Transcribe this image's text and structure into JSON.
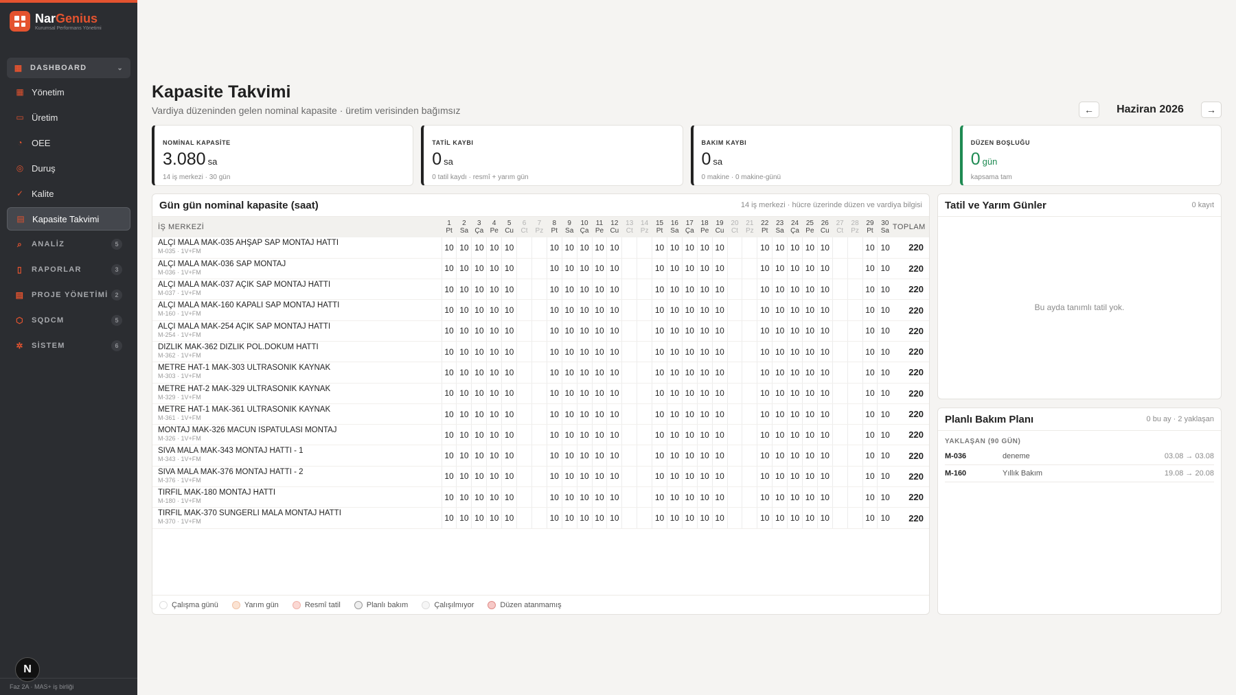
{
  "brand": {
    "name_a": "Nar",
    "name_b": "Genius",
    "subtitle": "Kurumsal Performans Yönetimi"
  },
  "sidebar": {
    "group_label": "DASHBOARD",
    "items": [
      {
        "label": "Yönetim",
        "icon": "grid-icon"
      },
      {
        "label": "Üretim",
        "icon": "factory-icon"
      },
      {
        "label": "OEE",
        "icon": "gauge-icon"
      },
      {
        "label": "Duruş",
        "icon": "pause-icon"
      },
      {
        "label": "Kalite",
        "icon": "check-icon"
      },
      {
        "label": "Kapasite Takvimi",
        "icon": "calendar-icon",
        "active": true
      }
    ],
    "sections": [
      {
        "label": "ANALİZ",
        "badge": "5",
        "icon": "search-icon"
      },
      {
        "label": "RAPORLAR",
        "badge": "3",
        "icon": "document-icon"
      },
      {
        "label": "PROJE YÖNETİMİ",
        "badge": "2",
        "icon": "board-icon"
      },
      {
        "label": "SQDCM",
        "badge": "5",
        "icon": "shield-icon"
      },
      {
        "label": "SİSTEM",
        "badge": "6",
        "icon": "gear-icon"
      }
    ],
    "avatar": "N",
    "footer": "Faz 2A · MAS+ iş birliği"
  },
  "page": {
    "title": "Kapasite Takvimi",
    "subtitle": "Vardiya düzeninden gelen nominal kapasite · üretim verisinden bağımsız",
    "month": "Haziran 2026",
    "prev": "←",
    "next": "→"
  },
  "kpis": [
    {
      "label": "NOMİNAL KAPASİTE",
      "value": "3.080",
      "unit": "sa",
      "foot": "14 iş merkezi · 30 gün"
    },
    {
      "label": "TATİL KAYBI",
      "value": "0",
      "unit": "sa",
      "foot": "0 tatil kaydı · resmî + yarım gün"
    },
    {
      "label": "BAKIM KAYBI",
      "value": "0",
      "unit": "sa",
      "foot": "0 makine · 0 makine-günü"
    },
    {
      "label": "DÜZEN BOŞLUĞU",
      "value": "0",
      "unit": "gün",
      "foot": "kapsama tam"
    }
  ],
  "table": {
    "title": "Gün gün nominal kapasite (saat)",
    "meta": "14 iş merkezi · hücre üzerinde düzen ve vardiya bilgisi",
    "col_wc": "İŞ MERKEZİ",
    "col_total": "TOPLAM",
    "days": [
      {
        "n": "1",
        "w": "Pt",
        "we": false
      },
      {
        "n": "2",
        "w": "Sa",
        "we": false
      },
      {
        "n": "3",
        "w": "Ça",
        "we": false
      },
      {
        "n": "4",
        "w": "Pe",
        "we": false
      },
      {
        "n": "5",
        "w": "Cu",
        "we": false
      },
      {
        "n": "6",
        "w": "Ct",
        "we": true
      },
      {
        "n": "7",
        "w": "Pz",
        "we": true
      },
      {
        "n": "8",
        "w": "Pt",
        "we": false
      },
      {
        "n": "9",
        "w": "Sa",
        "we": false
      },
      {
        "n": "10",
        "w": "Ça",
        "we": false
      },
      {
        "n": "11",
        "w": "Pe",
        "we": false
      },
      {
        "n": "12",
        "w": "Cu",
        "we": false
      },
      {
        "n": "13",
        "w": "Ct",
        "we": true
      },
      {
        "n": "14",
        "w": "Pz",
        "we": true
      },
      {
        "n": "15",
        "w": "Pt",
        "we": false
      },
      {
        "n": "16",
        "w": "Sa",
        "we": false
      },
      {
        "n": "17",
        "w": "Ça",
        "we": false
      },
      {
        "n": "18",
        "w": "Pe",
        "we": false
      },
      {
        "n": "19",
        "w": "Cu",
        "we": false
      },
      {
        "n": "20",
        "w": "Ct",
        "we": true
      },
      {
        "n": "21",
        "w": "Pz",
        "we": true
      },
      {
        "n": "22",
        "w": "Pt",
        "we": false
      },
      {
        "n": "23",
        "w": "Sa",
        "we": false
      },
      {
        "n": "24",
        "w": "Ça",
        "we": false
      },
      {
        "n": "25",
        "w": "Pe",
        "we": false
      },
      {
        "n": "26",
        "w": "Cu",
        "we": false
      },
      {
        "n": "27",
        "w": "Ct",
        "we": true
      },
      {
        "n": "28",
        "w": "Pz",
        "we": true
      },
      {
        "n": "29",
        "w": "Pt",
        "we": false
      },
      {
        "n": "30",
        "w": "Sa",
        "we": false
      }
    ],
    "work_value": "10",
    "rows": [
      {
        "name": "ALÇI MALA MAK-035 AHŞAP SAP MONTAJ HATTI",
        "sub": "M-035 · 1V+FM",
        "total": "220"
      },
      {
        "name": "ALÇI MALA MAK-036 SAP MONTAJ",
        "sub": "M-036 · 1V+FM",
        "total": "220"
      },
      {
        "name": "ALÇI MALA MAK-037 AÇIK SAP MONTAJ HATTI",
        "sub": "M-037 · 1V+FM",
        "total": "220"
      },
      {
        "name": "ALÇI MALA MAK-160 KAPALI SAP MONTAJ HATTI",
        "sub": "M-160 · 1V+FM",
        "total": "220"
      },
      {
        "name": "ALÇI MALA MAK-254 AÇIK SAP MONTAJ HATTI",
        "sub": "M-254 · 1V+FM",
        "total": "220"
      },
      {
        "name": "DİZLİK MAK-362 DİZLİK POL.DÖKÜM HATTI",
        "sub": "M-362 · 1V+FM",
        "total": "220"
      },
      {
        "name": "METRE HAT-1 MAK-303 ULTRASONİK KAYNAK",
        "sub": "M-303 · 1V+FM",
        "total": "220"
      },
      {
        "name": "METRE HAT-2 MAK-329 ULTRASONİK KAYNAK",
        "sub": "M-329 · 1V+FM",
        "total": "220"
      },
      {
        "name": "METRE HAT-1 MAK-361 ULTRASONİK KAYNAK",
        "sub": "M-361 · 1V+FM",
        "total": "220"
      },
      {
        "name": "MONTAJ MAK-326 MACUN ISPATULASI MONTAJ",
        "sub": "M-326 · 1V+FM",
        "total": "220"
      },
      {
        "name": "SIVA MALA MAK-343 MONTAJ HATTI - 1",
        "sub": "M-343 · 1V+FM",
        "total": "220"
      },
      {
        "name": "SIVA MALA MAK-376 MONTAJ HATTI - 2",
        "sub": "M-376 · 1V+FM",
        "total": "220"
      },
      {
        "name": "TIRFIL MAK-180 MONTAJ HATTI",
        "sub": "M-180 · 1V+FM",
        "total": "220"
      },
      {
        "name": "TIRFIL MAK-370 SÜNGERLİ MALA MONTAJ HATTI",
        "sub": "M-370 · 1V+FM",
        "total": "220"
      }
    ],
    "legend": [
      {
        "label": "Çalışma günü",
        "color": "#ffffff",
        "border": "#dddddd"
      },
      {
        "label": "Yarım gün",
        "color": "#fbe3d3",
        "border": "#f0c2a6"
      },
      {
        "label": "Resmî tatil",
        "color": "#fbd9d4",
        "border": "#f0b1a8"
      },
      {
        "label": "Planlı bakım",
        "color": "#eeeeee",
        "border": "#999999"
      },
      {
        "label": "Çalışılmıyor",
        "color": "#f6f6f6",
        "border": "#dddddd"
      },
      {
        "label": "Düzen atanmamış",
        "color": "#f6c9c7",
        "border": "#e08b87"
      }
    ]
  },
  "holidays": {
    "title": "Tatil ve Yarım Günler",
    "meta": "0 kayıt",
    "empty": "Bu ayda tanımlı tatil yok."
  },
  "maintenance": {
    "title": "Planlı Bakım Planı",
    "meta": "0 bu ay · 2 yaklaşan",
    "section": "YAKLAŞAN (90 GÜN)",
    "items": [
      {
        "code": "M-036",
        "name": "deneme",
        "dates": "03.08 → 03.08"
      },
      {
        "code": "M-160",
        "name": "Yıllık Bakım",
        "dates": "19.08 → 20.08"
      }
    ]
  }
}
